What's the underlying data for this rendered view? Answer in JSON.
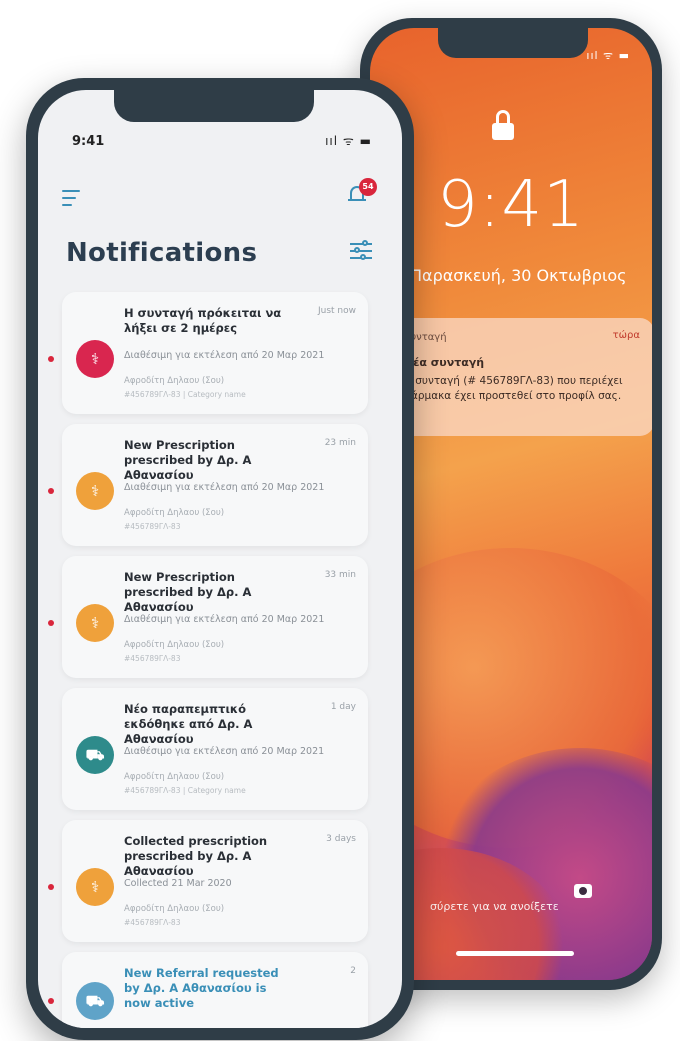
{
  "lock_screen": {
    "time": "9:41",
    "date": "Παρασκευή, 30 Οκτωβριος",
    "notification": {
      "app": "Συνταγή",
      "time_ago": "τώρα",
      "title": "Νέα συνταγή",
      "body": "Η συνταγή (# 456789ΓΛ-83) που περιέχει φάρμακα έχει προστεθεί στο προφίλ σας."
    },
    "swipe_hint": "σύρετε για να ανοίξετε"
  },
  "app": {
    "status_time": "9:41",
    "status_icons": "ııl ᯤ ▬",
    "page_title": "Notifications",
    "badge_count": "54",
    "notifications": [
      {
        "title": "Η συνταγή πρόκειται να λήξει σε 2 ημέρες",
        "time": "Just now",
        "line1": "Διαθέσιμη για εκτέλεση από 20 Μαρ 2021",
        "line2": "Αφροδίτη Δηλαου (Σου)",
        "line3": "#456789ΓΛ-83 | Category name",
        "avatar_color": "#d9264f",
        "unread": true
      },
      {
        "title": "New Prescription prescribed by Δρ. Α Αθανασίου",
        "time": "23 min",
        "line1": "Διαθέσιμη για εκτέλεση από 20 Μαρ 2021",
        "line2": "Αφροδίτη Δηλαου (Σου)",
        "line3": "#456789ΓΛ-83",
        "avatar_color": "#efa13b",
        "unread": true
      },
      {
        "title": "New Prescription prescribed by Δρ. Α Αθανασίου",
        "time": "33 min",
        "line1": "Διαθέσιμη για εκτέλεση από 20 Μαρ 2021",
        "line2": "Αφροδίτη Δηλαου (Σου)",
        "line3": "#456789ΓΛ-83",
        "avatar_color": "#efa13b",
        "unread": true
      },
      {
        "title": "Νέο παραπεμπτικό εκδόθηκε από Δρ. Α Αθανασίου",
        "time": "1 day",
        "line1": "Διαθέσιμο για εκτέλεση από 20 Μαρ 2021",
        "line2": "Αφροδίτη Δηλαου (Σου)",
        "line3": "#456789ΓΛ-83 | Category name",
        "avatar_color": "#2e8b8b",
        "unread": false
      },
      {
        "title": "Collected prescription prescribed by Δρ. Α Αθανασίου",
        "time": "3 days",
        "line1": "Collected 21 Mar 2020",
        "line2": "Αφροδίτη Δηλαου (Σου)",
        "line3": "#456789ΓΛ-83",
        "avatar_color": "#efa13b",
        "unread": true
      },
      {
        "title": "New Referral requested by Δρ. Α Αθανασίου is now active",
        "time": "2",
        "avatar_color": "#5fa3c8",
        "unread": true
      }
    ]
  }
}
